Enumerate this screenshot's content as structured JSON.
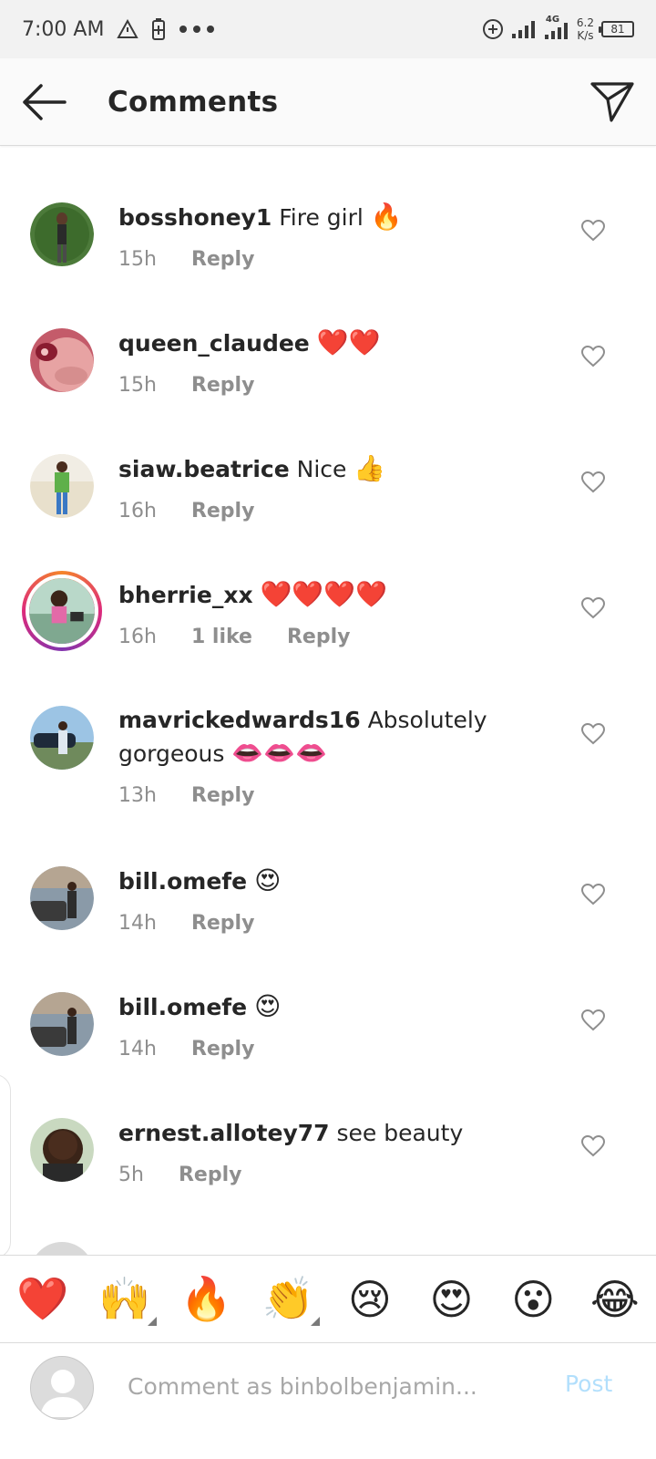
{
  "status_bar": {
    "time": "7:00 AM",
    "network_badge": "4G",
    "speed_value": "6.2",
    "speed_unit": "K/s",
    "battery": "81"
  },
  "header": {
    "title": "Comments",
    "back_icon": "back-arrow-icon",
    "send_icon": "paper-plane-icon"
  },
  "comments": [
    {
      "username": "bosshoney1",
      "text": "Fire girl",
      "emoji": "🔥",
      "time": "15h",
      "likes": "",
      "reply": "Reply"
    },
    {
      "username": "queen_claudee",
      "text": "",
      "emoji": "❤️❤️",
      "time": "15h",
      "likes": "",
      "reply": "Reply"
    },
    {
      "username": "siaw.beatrice",
      "text": "Nice",
      "emoji": "👍",
      "time": "16h",
      "likes": "",
      "reply": "Reply"
    },
    {
      "username": "bherrie_xx",
      "text": "",
      "emoji": "❤️❤️❤️❤️",
      "time": "16h",
      "likes": "1 like",
      "reply": "Reply"
    },
    {
      "username": "mavrickedwards16",
      "text": "Absolutely gorgeous",
      "emoji": "👄👄👄",
      "time": "13h",
      "likes": "",
      "reply": "Reply"
    },
    {
      "username": "bill.omefe",
      "text": "",
      "emoji": "😍",
      "time": "14h",
      "likes": "",
      "reply": "Reply"
    },
    {
      "username": "bill.omefe",
      "text": "",
      "emoji": "😍",
      "time": "14h",
      "likes": "",
      "reply": "Reply"
    },
    {
      "username": "ernest.allotey77",
      "text": "see beauty",
      "emoji": "",
      "time": "5h",
      "likes": "",
      "reply": "Reply"
    }
  ],
  "emoji_bar": [
    "❤️",
    "🙌",
    "🔥",
    "👏",
    "😢",
    "😍",
    "😮",
    "😂"
  ],
  "composer": {
    "placeholder": "Comment as binbolbenjamin...",
    "post_label": "Post"
  },
  "colors": {
    "header_bg": "#fafafa",
    "meta_text": "#8e8e8e",
    "post_disabled": "#b2dffc",
    "story_ring_start": "#f58529",
    "story_ring_end": "#dd2a7b"
  }
}
